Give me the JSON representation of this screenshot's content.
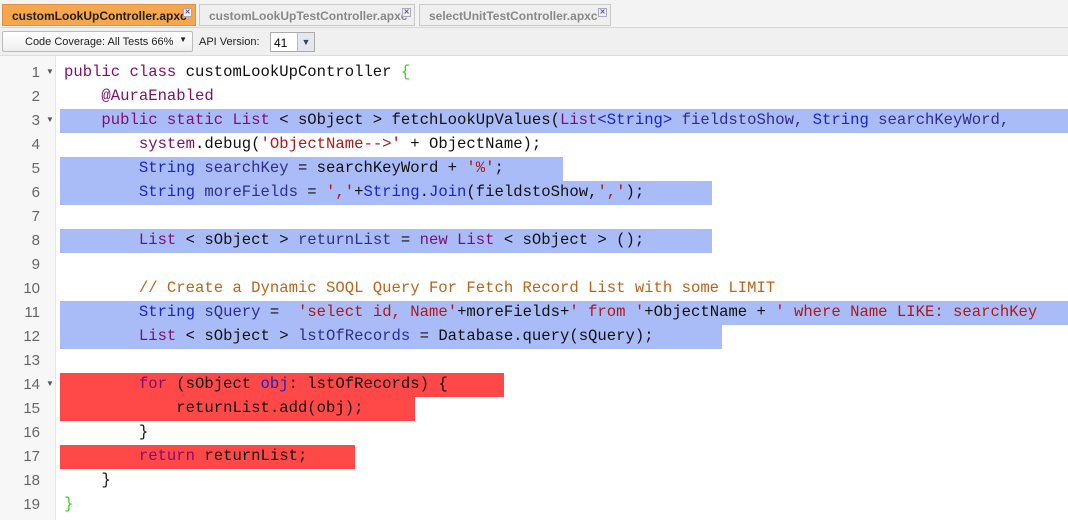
{
  "tabs": [
    {
      "label": "customLookUpController.apxc",
      "active": true
    },
    {
      "label": "customLookUpTestController.apxc",
      "active": false
    },
    {
      "label": "selectUnitTestController.apxc",
      "active": false
    }
  ],
  "toolbar": {
    "coverage_label": "Code Coverage: All Tests 66%",
    "api_label": "API Version:",
    "api_value": "41"
  },
  "colors": {
    "covered": "#aabcf7",
    "uncovered": "#ff4848",
    "active_tab": "#f6a64c"
  },
  "lines": [
    {
      "n": "1",
      "fold": true,
      "hl": null,
      "tokens": [
        [
          "public class ",
          "k"
        ],
        [
          "customLookUpController ",
          "p"
        ],
        [
          "{",
          "g"
        ]
      ]
    },
    {
      "n": "2",
      "hl": null,
      "tokens": [
        [
          "    @AuraEnabled",
          "k"
        ]
      ]
    },
    {
      "n": "3",
      "fold": true,
      "hl": "covered",
      "full": true,
      "tokens": [
        [
          "    public static List",
          "k"
        ],
        [
          " < sObject > fetchLookUpValues(",
          "p"
        ],
        [
          "List",
          "k"
        ],
        [
          "<String>",
          "t"
        ],
        [
          " fieldstoShow, ",
          "v"
        ],
        [
          "String",
          "t"
        ],
        [
          " searchKeyWord,",
          "v"
        ]
      ]
    },
    {
      "n": "4",
      "hl": null,
      "tokens": [
        [
          "        system",
          "k"
        ],
        [
          ".debug(",
          "p"
        ],
        [
          "'ObjectName-->'",
          "s"
        ],
        [
          " + ObjectName);",
          "p"
        ]
      ]
    },
    {
      "n": "5",
      "hl": "covered",
      "end": 563,
      "tokens": [
        [
          "        String",
          "t"
        ],
        [
          " searchKey",
          "v"
        ],
        [
          " = searchKeyWord + ",
          "p"
        ],
        [
          "'%'",
          "s"
        ],
        [
          ";",
          "p"
        ]
      ]
    },
    {
      "n": "6",
      "hl": "covered",
      "end": 712,
      "tokens": [
        [
          "        String",
          "t"
        ],
        [
          " moreFields",
          "v"
        ],
        [
          " = ",
          "p"
        ],
        [
          "','",
          "s"
        ],
        [
          "+",
          "p"
        ],
        [
          "String",
          "t"
        ],
        [
          ".",
          "p"
        ],
        [
          "Join",
          "t"
        ],
        [
          "(fieldstoShow,",
          "p"
        ],
        [
          "','",
          "s"
        ],
        [
          ");",
          "p"
        ]
      ]
    },
    {
      "n": "7",
      "hl": null,
      "tokens": []
    },
    {
      "n": "8",
      "hl": "covered",
      "end": 712,
      "tokens": [
        [
          "        List",
          "k"
        ],
        [
          " < sObject > ",
          "p"
        ],
        [
          "returnList",
          "v"
        ],
        [
          " = ",
          "p"
        ],
        [
          "new List",
          "k"
        ],
        [
          " < sObject > ();",
          "p"
        ]
      ]
    },
    {
      "n": "9",
      "hl": null,
      "tokens": []
    },
    {
      "n": "10",
      "hl": null,
      "tokens": [
        [
          "        // Create a Dynamic SOQL Query For Fetch Record List with some LIMIT",
          "c"
        ]
      ]
    },
    {
      "n": "11",
      "hl": "covered",
      "full": true,
      "tokens": [
        [
          "        String",
          "t"
        ],
        [
          " sQuery",
          "v"
        ],
        [
          " =  ",
          "p"
        ],
        [
          "'select id, Name'",
          "s"
        ],
        [
          "+moreFields+",
          "p"
        ],
        [
          "' from '",
          "s"
        ],
        [
          "+ObjectName + ",
          "p"
        ],
        [
          "' where Name LIKE: searchKey",
          "s"
        ]
      ]
    },
    {
      "n": "12",
      "hl": "covered",
      "end": 722,
      "tokens": [
        [
          "        List",
          "k"
        ],
        [
          " < sObject > ",
          "p"
        ],
        [
          "lstOfRecords",
          "v"
        ],
        [
          " = Database.query(sQuery);",
          "p"
        ]
      ]
    },
    {
      "n": "13",
      "hl": null,
      "tokens": []
    },
    {
      "n": "14",
      "fold": true,
      "hl": "uncovered",
      "end": 504,
      "tokens": [
        [
          "        for",
          "k"
        ],
        [
          " (sObject ",
          "p"
        ],
        [
          "obj",
          "t"
        ],
        [
          ": lstOfRecords) {",
          "p"
        ]
      ]
    },
    {
      "n": "15",
      "hl": "uncovered",
      "end": 415,
      "tokens": [
        [
          "            returnList.add(obj);",
          "p"
        ]
      ]
    },
    {
      "n": "16",
      "hl": null,
      "tokens": [
        [
          "        }",
          "p"
        ]
      ]
    },
    {
      "n": "17",
      "hl": "uncovered",
      "end": 355,
      "tokens": [
        [
          "        return",
          "k"
        ],
        [
          " returnList;",
          "p"
        ]
      ]
    },
    {
      "n": "18",
      "hl": null,
      "tokens": [
        [
          "    }",
          "p"
        ]
      ]
    },
    {
      "n": "19",
      "hl": null,
      "tokens": [
        [
          "}",
          "g"
        ]
      ]
    }
  ]
}
